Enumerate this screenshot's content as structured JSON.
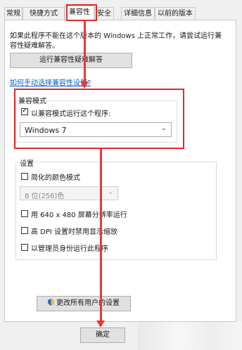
{
  "tabs": [
    "常规",
    "快捷方式",
    "兼容性",
    "安全",
    "详细信息",
    "以前的版本"
  ],
  "intro_text_line1": "如果此程序不能在这个版本的 Windows 上正常工作，请尝试运行兼",
  "intro_text_line2": "容性疑难解答。",
  "troubleshoot_button": "运行兼容性疑难解答",
  "manual_link": "如何手动选择兼容性设置?",
  "compat_mode": {
    "title": "兼容模式",
    "checkbox_label": "以兼容模式运行这个程序:",
    "checked": true,
    "selected_os": "Windows 7"
  },
  "settings": {
    "title": "设置",
    "reduced_color": "简化的颜色模式",
    "color_option": "8 位(256)色",
    "run_640": "用 640 x 480 屏幕分辨率运行",
    "high_dpi": "高 DPI 设置时禁用显示缩放",
    "run_admin": "以管理员身份运行此程序"
  },
  "change_all_button": "更改所有用户的设置",
  "ok_button": "确定",
  "colors": {
    "highlight": "#e02b2b",
    "link": "#0066cc"
  }
}
